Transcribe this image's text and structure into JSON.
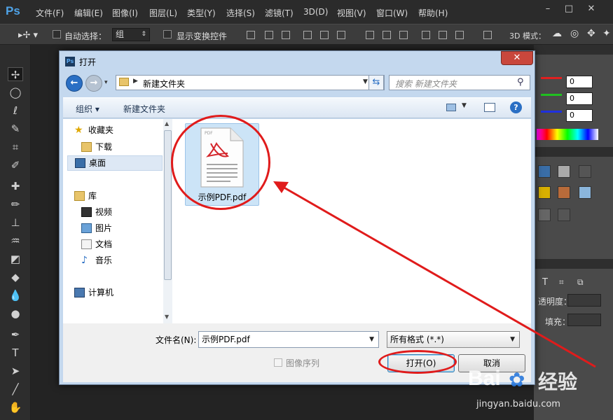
{
  "app": {
    "logo": "Ps",
    "menu": [
      "文件(F)",
      "编辑(E)",
      "图像(I)",
      "图层(L)",
      "类型(Y)",
      "选择(S)",
      "滤镜(T)",
      "3D(D)",
      "视图(V)",
      "窗口(W)",
      "帮助(H)"
    ],
    "window_controls": [
      "–",
      "□",
      "✕"
    ]
  },
  "options": {
    "auto_select_label": "自动选择：",
    "auto_select_value": "组",
    "show_transform_label": "显示变换控件",
    "mode_label": "3D 模式："
  },
  "panels": {
    "rgb_values": [
      "0",
      "0",
      "0"
    ],
    "opacity_label": "透明度：",
    "fill_label": "填充："
  },
  "dialog": {
    "title": "打开",
    "close_glyph": "✕",
    "address_path": "新建文件夹",
    "search_placeholder": "搜索 新建文件夹",
    "cmd_organize": "组织 ▾",
    "cmd_new_folder": "新建文件夹",
    "nav": {
      "favorites": "收藏夹",
      "downloads": "下载",
      "desktop": "桌面",
      "libraries": "库",
      "videos": "视频",
      "pictures": "图片",
      "documents": "文档",
      "music": "音乐",
      "computer": "计算机"
    },
    "file": {
      "name": "示例PDF.pdf",
      "icon_caption": "PDF"
    },
    "filename_label": "文件名(N):",
    "filename_value": "示例PDF.pdf",
    "format_value": "所有格式 (*.*)",
    "image_sequence_label": "图像序列",
    "open_button": "打开(O)",
    "cancel_button": "取消"
  },
  "watermark": {
    "brand": "Bai",
    "brand_cn": "经验",
    "url": "jingyan.baidu.com"
  },
  "colors": {
    "annotation_red": "#e01b1b",
    "ps_blue": "#4fa3e8"
  }
}
